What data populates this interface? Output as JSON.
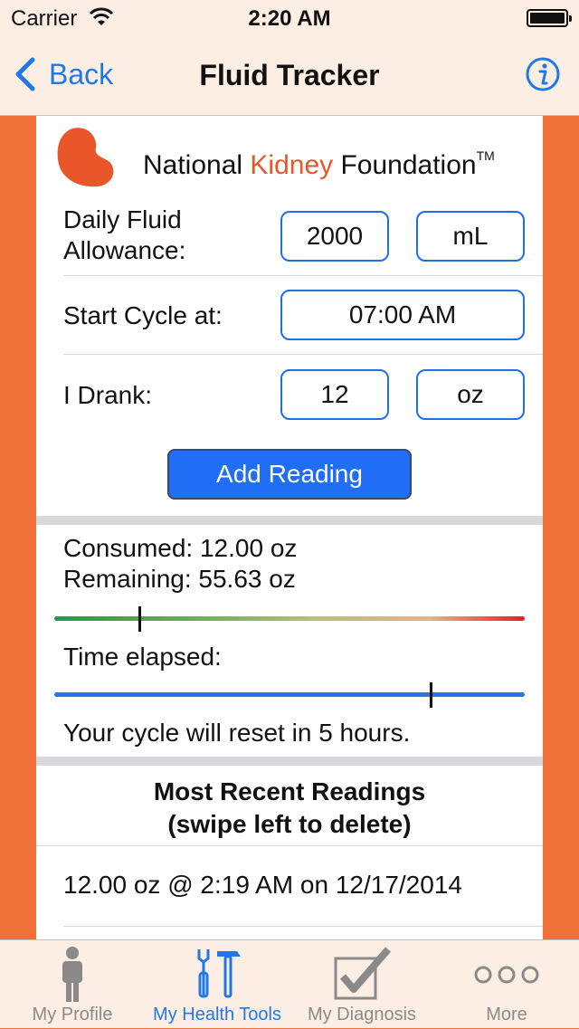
{
  "status": {
    "carrier": "Carrier",
    "time": "2:20 AM"
  },
  "nav": {
    "back_label": "Back",
    "title": "Fluid Tracker"
  },
  "org": {
    "part1": "National ",
    "part2": "Kidney",
    "part3": " Foundation",
    "tm": "TM"
  },
  "form": {
    "allowance_label_line1": "Daily Fluid",
    "allowance_label_line2": "Allowance:",
    "allowance_value": "2000",
    "allowance_unit": "mL",
    "start_label": "Start Cycle at:",
    "start_value": "07:00 AM",
    "drank_label": "I Drank:",
    "drank_value": "12",
    "drank_unit": "oz",
    "add_button": "Add Reading"
  },
  "progress": {
    "consumed": "Consumed: 12.00 oz",
    "remaining": "Remaining: 55.63 oz",
    "consumed_fraction": 0.18,
    "time_label": "Time elapsed:",
    "time_fraction": 0.8,
    "reset_text": "Your cycle will reset in 5 hours."
  },
  "recent": {
    "title_line1": "Most Recent Readings",
    "title_line2": "(swipe left to delete)",
    "readings": [
      "12.00 oz @ 2:19 AM on 12/17/2014"
    ]
  },
  "tabs": [
    {
      "label": "My Profile",
      "icon": "person-icon"
    },
    {
      "label": "My Health Tools",
      "icon": "tools-icon"
    },
    {
      "label": "My Diagnosis",
      "icon": "checkbox-icon"
    },
    {
      "label": "More",
      "icon": "more-icon"
    }
  ],
  "colors": {
    "accent": "#1f7ae8",
    "brand_orange": "#ef7038",
    "kidney": "#e8562a"
  }
}
